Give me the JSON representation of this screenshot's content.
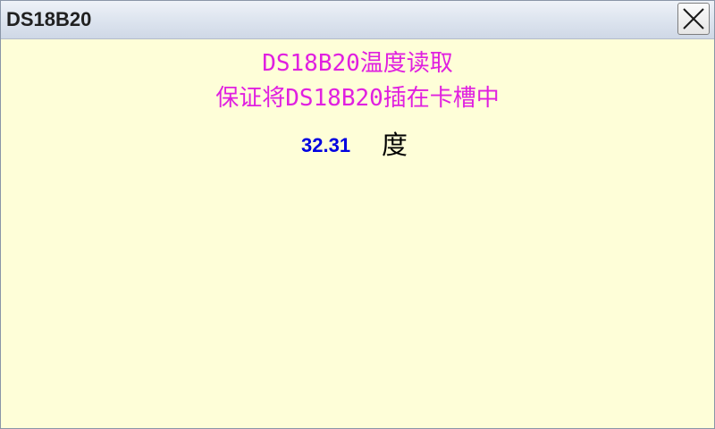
{
  "window": {
    "title": "DS18B20",
    "close_icon": "close-x-icon"
  },
  "main": {
    "heading_line1": "DS18B20温度读取",
    "heading_line2": "保证将DS18B20插在卡槽中",
    "temperature_value": "32.31",
    "temperature_unit": "度"
  },
  "colors": {
    "heading": "#e020e0",
    "value": "#0000e0",
    "background": "#fefed8"
  }
}
